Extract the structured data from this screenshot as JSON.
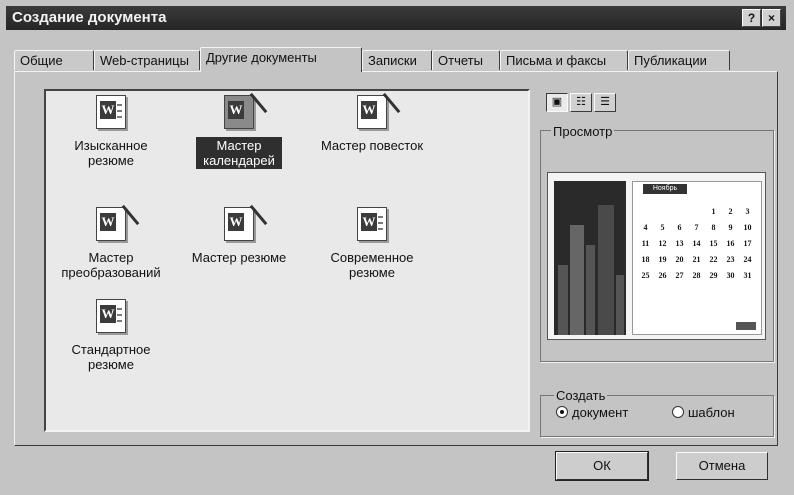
{
  "window": {
    "title": "Создание документа"
  },
  "title_buttons": {
    "help": "?",
    "close": "×"
  },
  "tabs": [
    {
      "label": "Общие",
      "active": false
    },
    {
      "label": "Web-страницы",
      "active": false
    },
    {
      "label": "Другие документы",
      "active": true
    },
    {
      "label": "Записки",
      "active": false
    },
    {
      "label": "Отчеты",
      "active": false
    },
    {
      "label": "Письма и факсы",
      "active": false
    },
    {
      "label": "Публикации",
      "active": false
    }
  ],
  "templates": [
    {
      "label": "Изысканное резюме",
      "selected": false,
      "icon": "word-document-icon"
    },
    {
      "label": "Мастер календарей",
      "selected": true,
      "icon": "word-wizard-icon"
    },
    {
      "label": "Мастер повесток",
      "selected": false,
      "icon": "word-wizard-icon"
    },
    {
      "label": "Мастер преобразований",
      "selected": false,
      "icon": "word-wizard-icon"
    },
    {
      "label": "Мастер резюме",
      "selected": false,
      "icon": "word-wizard-icon"
    },
    {
      "label": "Современное резюме",
      "selected": false,
      "icon": "word-document-icon"
    },
    {
      "label": "Стандартное резюме",
      "selected": false,
      "icon": "word-document-icon"
    }
  ],
  "view_buttons": [
    {
      "icon": "large-icons-view-icon",
      "active": true
    },
    {
      "icon": "list-view-icon",
      "active": false
    },
    {
      "icon": "details-view-icon",
      "active": false
    }
  ],
  "preview": {
    "label": "Просмотр",
    "calendar": {
      "month": "Ноябрь",
      "days": [
        "",
        "",
        "",
        "",
        "1",
        "2",
        "3",
        "4",
        "5",
        "6",
        "7",
        "8",
        "9",
        "10",
        "11",
        "12",
        "13",
        "14",
        "15",
        "16",
        "17",
        "18",
        "19",
        "20",
        "21",
        "22",
        "23",
        "24",
        "25",
        "26",
        "27",
        "28",
        "29",
        "30",
        "31"
      ]
    }
  },
  "create": {
    "label": "Создать",
    "options": [
      {
        "label": "документ",
        "checked": true
      },
      {
        "label": "шаблон",
        "checked": false
      }
    ]
  },
  "buttons": {
    "ok": "ОК",
    "cancel": "Отмена"
  }
}
